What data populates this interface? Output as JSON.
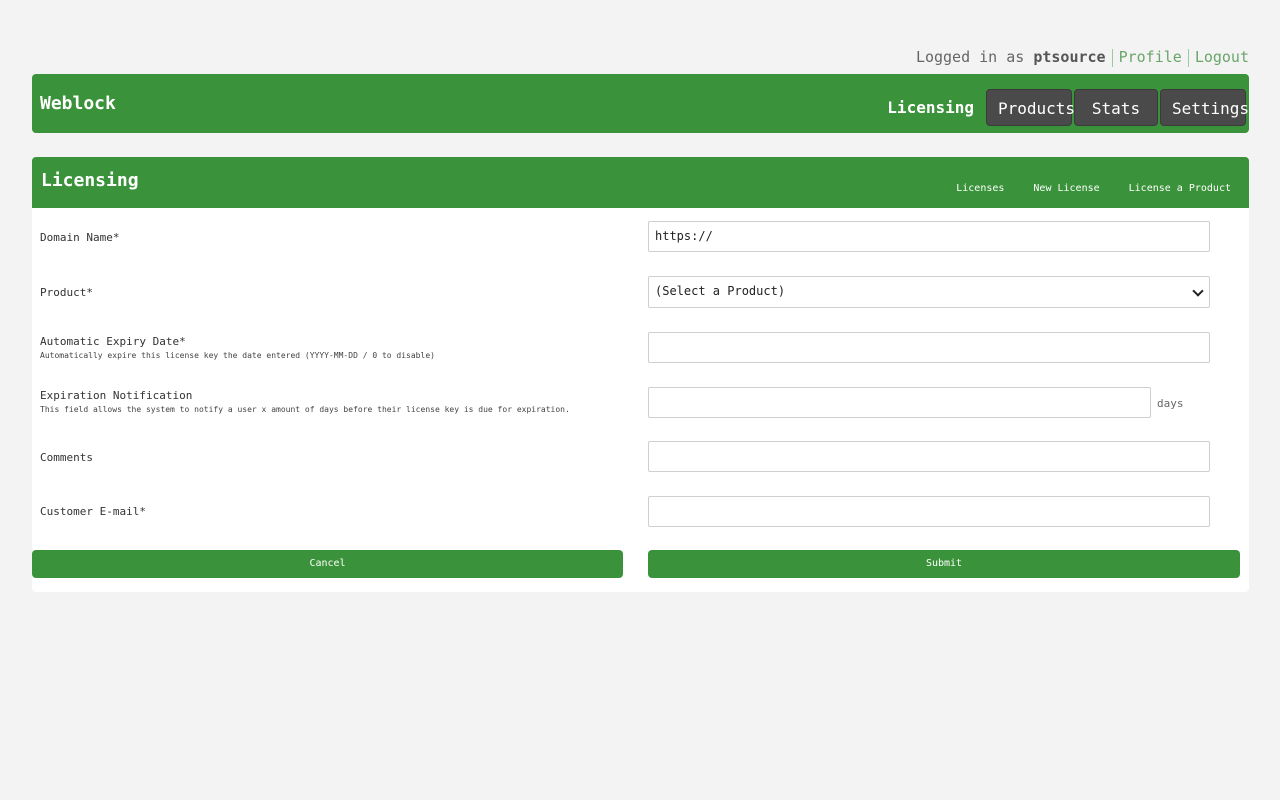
{
  "userbar": {
    "prefix": "Logged in as",
    "username": "ptsource",
    "profile_label": "Profile",
    "logout_label": "Logout"
  },
  "header": {
    "brand": "Weblock",
    "active_nav": "Licensing",
    "nav": [
      "Products",
      "Stats",
      "Settings"
    ]
  },
  "panel": {
    "title": "Licensing",
    "subnav": [
      "Licenses",
      "New License",
      "License a Product"
    ]
  },
  "form": {
    "domain": {
      "label": "Domain Name*",
      "value": "https://"
    },
    "product": {
      "label": "Product*",
      "selected": "(Select a Product)"
    },
    "expiry": {
      "label": "Automatic Expiry Date*",
      "help": "Automatically expire this license key the date entered (YYYY-MM-DD / 0 to disable)",
      "value": ""
    },
    "notification": {
      "label": "Expiration Notification",
      "help": "This field allows the system to notify a user x amount of days before their license key is due for expiration.",
      "value": "",
      "suffix": "days"
    },
    "comments": {
      "label": "Comments",
      "value": ""
    },
    "email": {
      "label": "Customer E-mail*",
      "value": ""
    },
    "cancel_label": "Cancel",
    "submit_label": "Submit"
  },
  "colors": {
    "brand_green": "#3a923a",
    "nav_button": "#4a4a4a",
    "link_green": "#6aa56a",
    "background": "#f3f3f3"
  }
}
